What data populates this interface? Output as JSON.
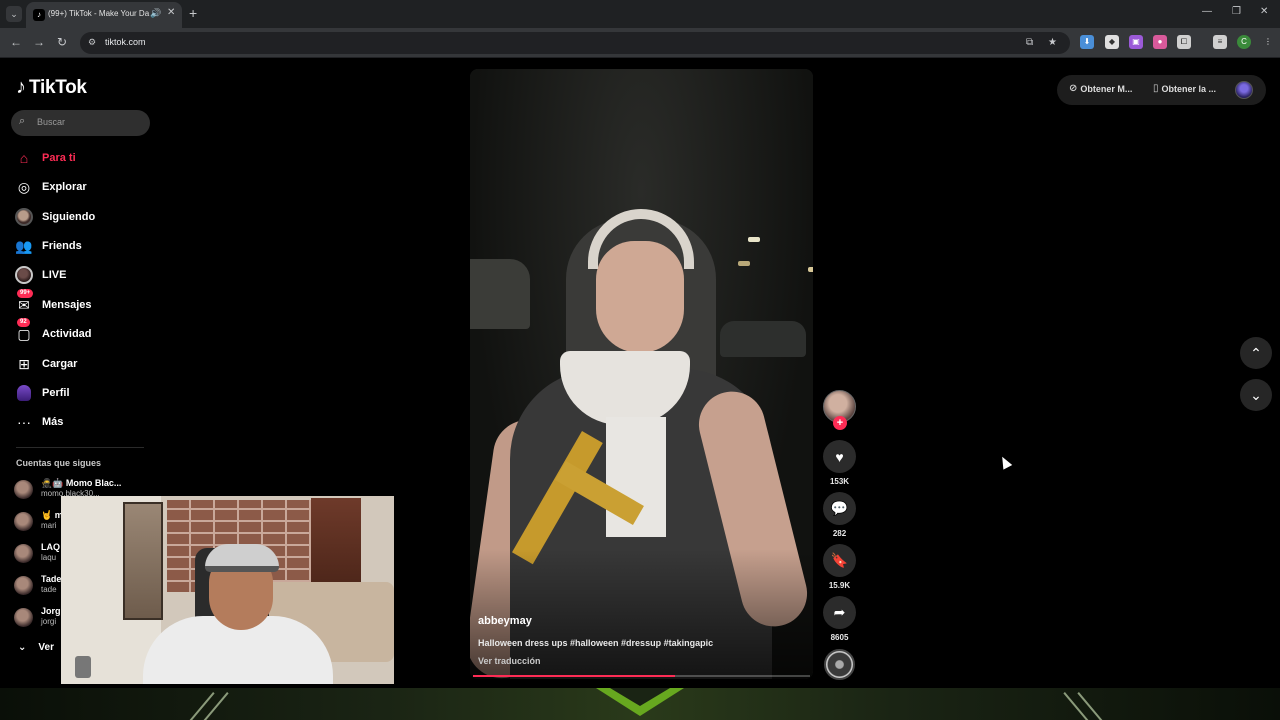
{
  "browser": {
    "tab_title": "(99+) TikTok - Make Your Da",
    "tab_favicon": "tiktok-icon",
    "url": "tiktok.com",
    "extension_colors": [
      "#4a8fd8",
      "#e0e0e0",
      "#9b5ad8",
      "#d85a9b",
      "#d0d0d0",
      "#d0d0d0",
      "#3a8a3a"
    ]
  },
  "tiktok": {
    "logo_text": "TikTok",
    "search_placeholder": "Buscar",
    "nav": [
      {
        "label": "Para ti",
        "icon": "home-icon",
        "active": true
      },
      {
        "label": "Explorar",
        "icon": "compass-icon"
      },
      {
        "label": "Siguiendo",
        "icon": "following-avatar-icon"
      },
      {
        "label": "Friends",
        "icon": "friends-icon"
      },
      {
        "label": "LIVE",
        "icon": "live-avatar-icon"
      },
      {
        "label": "Mensajes",
        "icon": "messages-icon",
        "badge": "99+"
      },
      {
        "label": "Actividad",
        "icon": "activity-icon",
        "badge": "92"
      },
      {
        "label": "Cargar",
        "icon": "upload-icon"
      },
      {
        "label": "Perfil",
        "icon": "profile-icon"
      },
      {
        "label": "Más",
        "icon": "more-icon"
      }
    ],
    "following_title": "Cuentas que sigues",
    "accounts": [
      {
        "name": "🥷🤖 Momo Blac...",
        "user": "momo.black30..."
      },
      {
        "name": "🤘 m",
        "user": "mari"
      },
      {
        "name": "LAQ",
        "user": "laqu"
      },
      {
        "name": "Tade",
        "user": "tade"
      },
      {
        "name": "Jorg",
        "user": "jorgi"
      }
    ],
    "see_more": "Ver"
  },
  "video": {
    "username": "abbeymay",
    "caption": "Halloween dress ups #halloween #dressup #takingapic",
    "translate_label": "Ver traducción",
    "progress": 0.6
  },
  "actions": {
    "likes": "153K",
    "comments": "282",
    "saves": "15.9K",
    "shares": "8605"
  },
  "top_actions": {
    "app_label": "Obtener M...",
    "download_label": "Obtener la ..."
  },
  "colors": {
    "accent": "#fe2c55",
    "background": "#000000"
  }
}
